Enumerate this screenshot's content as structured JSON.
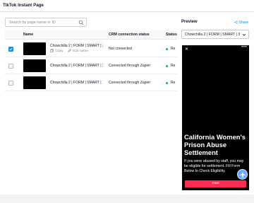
{
  "app": {
    "title": "TikTok Instant Page"
  },
  "search": {
    "placeholder": "Search by page name or ID"
  },
  "table": {
    "headers": {
      "name": "Name",
      "crm": "CRM connection status",
      "status": "Status"
    },
    "rows": [
      {
        "name": "Chowchilla 2 | FORM | SMART | 3...",
        "crm": "Not connected",
        "status": "Re",
        "checked": true,
        "copy_label": "Copy",
        "edit_label": "Edit name"
      },
      {
        "name": "Chowchilla 2 | FORM | SMART | 2...",
        "crm": "Connected through Zapier",
        "status": "Re",
        "checked": false
      },
      {
        "name": "Chowchilla 2 | FORM | SMART | 1",
        "crm": "Connected through Zapier",
        "status": "Re",
        "checked": false
      }
    ]
  },
  "preview": {
    "label": "Preview",
    "share_label": "Share",
    "selected_page": "Chowchilla 2 | FORM | SMART | 3",
    "phone": {
      "close_glyph": "✕",
      "menu_glyph": "•••",
      "heading": "California Women's Prison Abuse Settlement",
      "body": "If you were abused by staff, you may be eligible for settlement. Fill Form Below to Check Eligibility.",
      "cta": "Start"
    }
  },
  "colors": {
    "accent": "#1b8ee2",
    "status_green": "#17b26a",
    "cta_red": "#fe2c55"
  },
  "icons": [
    "search-icon",
    "check-icon",
    "copy-icon",
    "edit-icon",
    "share-icon",
    "chevron-down-icon",
    "close-icon",
    "more-icon",
    "plane-icon"
  ]
}
